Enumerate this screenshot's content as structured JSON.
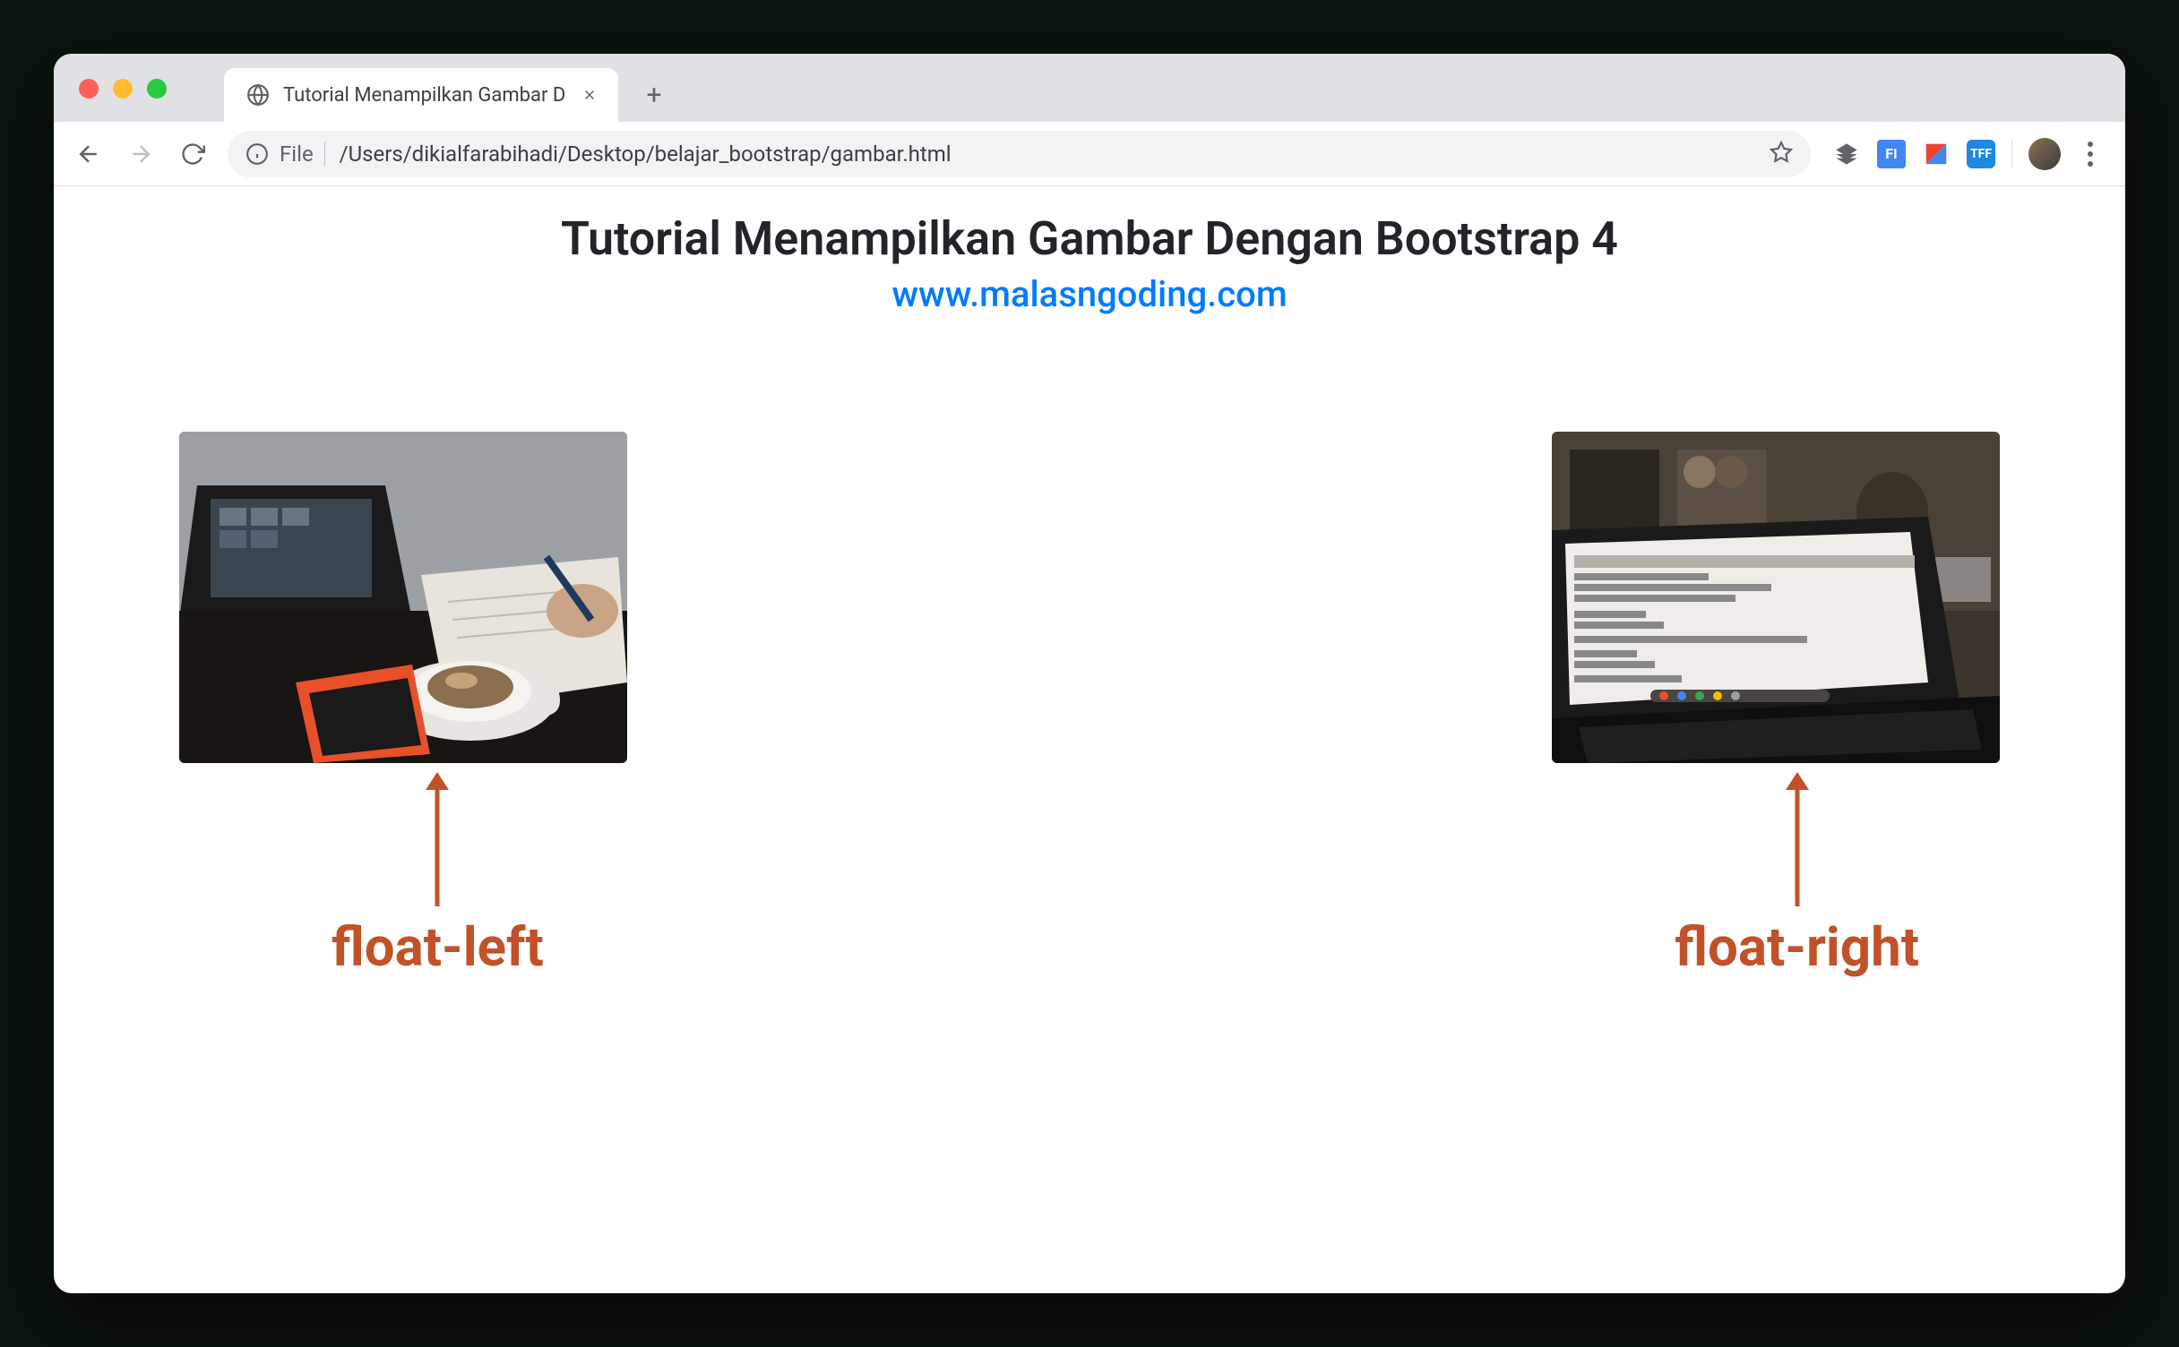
{
  "browser": {
    "tab_title": "Tutorial Menampilkan Gambar D",
    "url_scheme": "File",
    "url_path": "/Users/dikialfarabihadi/Desktop/belajar_bootstrap/gambar.html"
  },
  "content": {
    "heading": "Tutorial Menampilkan Gambar Dengan Bootstrap 4",
    "link_text": "www.malasngoding.com"
  },
  "annotations": {
    "left_label": "float-left",
    "right_label": "float-right"
  }
}
